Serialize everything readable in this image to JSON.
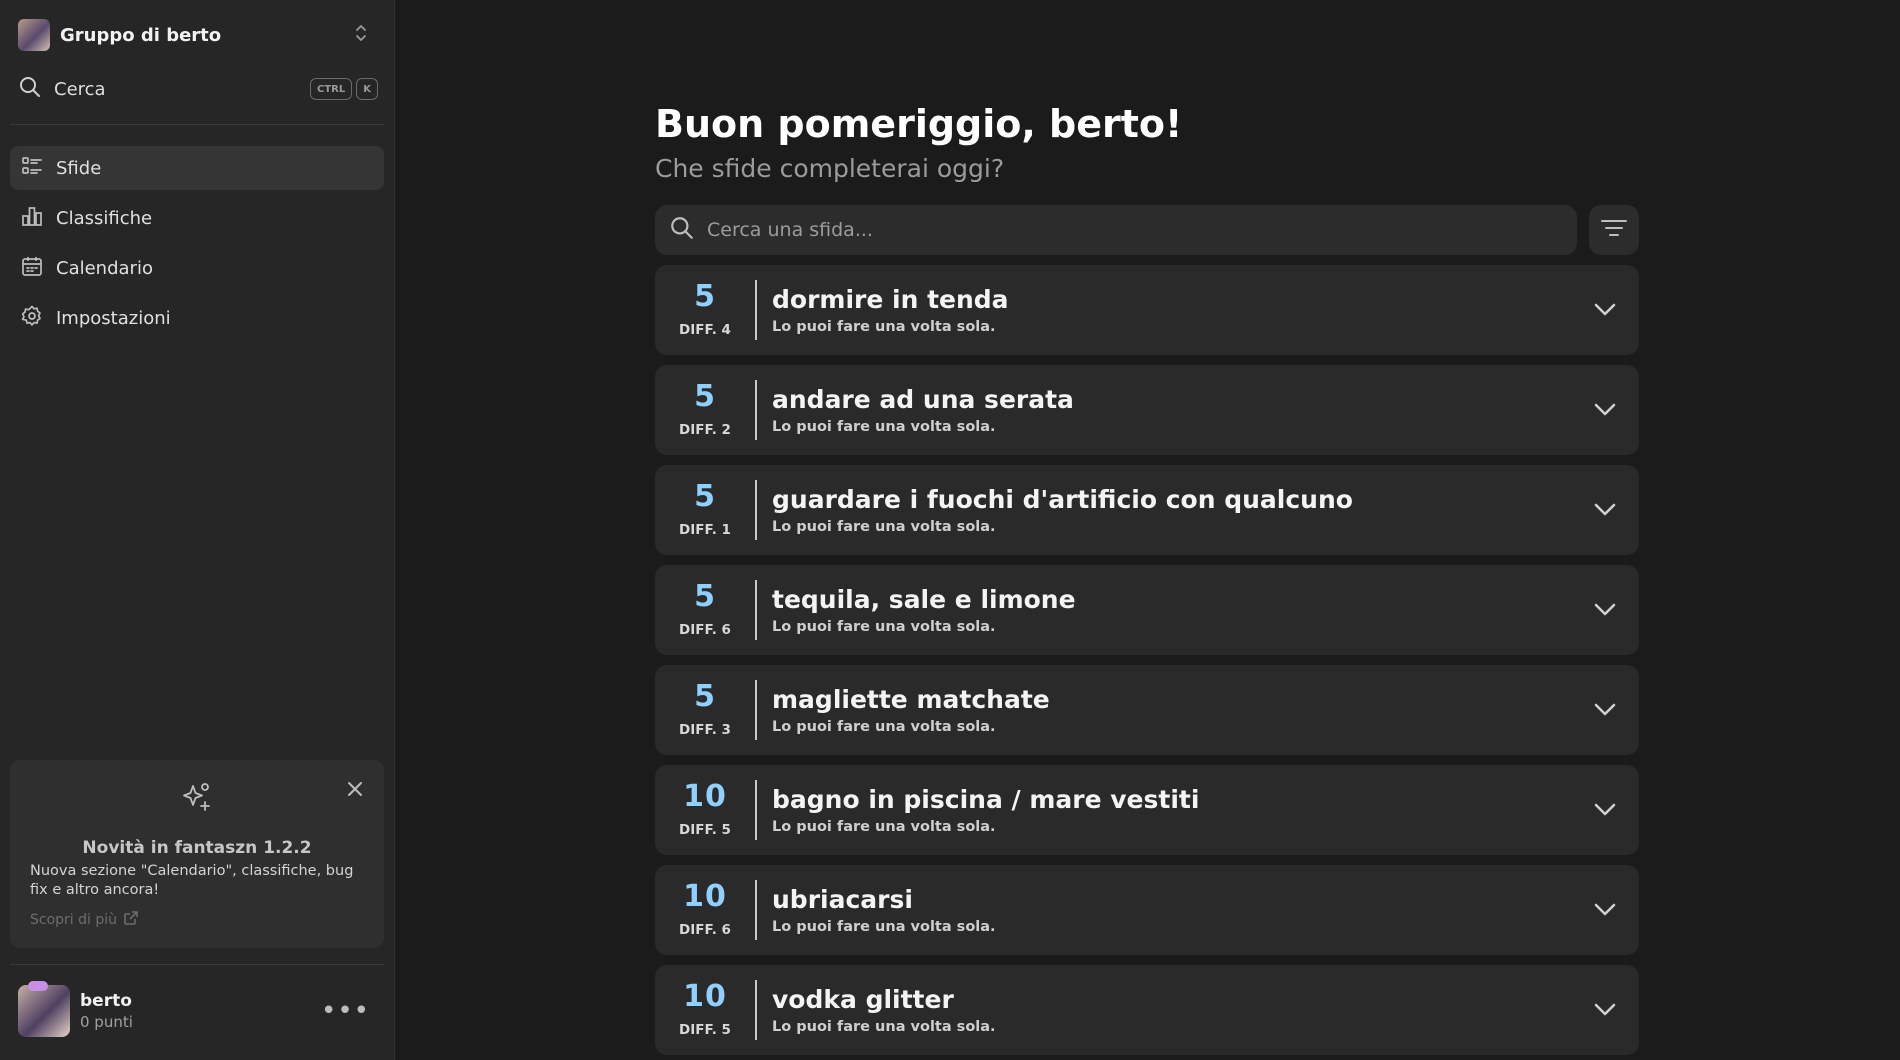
{
  "sidebar": {
    "group_name": "Gruppo di berto",
    "search_label": "Cerca",
    "shortcut": [
      "CTRL",
      "K"
    ],
    "nav": [
      {
        "label": "Sfide",
        "icon": "list-icon",
        "active": true
      },
      {
        "label": "Classifiche",
        "icon": "bar-chart-icon",
        "active": false
      },
      {
        "label": "Calendario",
        "icon": "calendar-icon",
        "active": false
      },
      {
        "label": "Impostazioni",
        "icon": "gear-icon",
        "active": false
      }
    ],
    "news": {
      "title": "Novità in fantaszn 1.2.2",
      "body": "Nuova sezione \"Calendario\", classifiche, bug fix e altro ancora!",
      "link": "Scopri di più"
    },
    "user": {
      "name": "berto",
      "points": "0 punti"
    }
  },
  "main": {
    "greeting": "Buon pomeriggio, berto!",
    "subtitle": "Che sfide completerai oggi?",
    "search_placeholder": "Cerca una sfida...",
    "challenges": [
      {
        "points": "5",
        "diff": "DIFF. 4",
        "title": "dormire in tenda",
        "note": "Lo puoi fare una volta sola."
      },
      {
        "points": "5",
        "diff": "DIFF. 2",
        "title": "andare ad una serata",
        "note": "Lo puoi fare una volta sola."
      },
      {
        "points": "5",
        "diff": "DIFF. 1",
        "title": "guardare i fuochi d'artificio con qualcuno",
        "note": "Lo puoi fare una volta sola."
      },
      {
        "points": "5",
        "diff": "DIFF. 6",
        "title": "tequila, sale e limone",
        "note": "Lo puoi fare una volta sola."
      },
      {
        "points": "5",
        "diff": "DIFF. 3",
        "title": "magliette matchate",
        "note": "Lo puoi fare una volta sola."
      },
      {
        "points": "10",
        "diff": "DIFF. 5",
        "title": "bagno in piscina / mare vestiti",
        "note": "Lo puoi fare una volta sola."
      },
      {
        "points": "10",
        "diff": "DIFF. 6",
        "title": "ubriacarsi",
        "note": "Lo puoi fare una volta sola."
      },
      {
        "points": "10",
        "diff": "DIFF. 5",
        "title": "vodka glitter",
        "note": "Lo puoi fare una volta sola."
      }
    ]
  },
  "colors": {
    "accent_points": "#8fd0ff",
    "background": "#1b1b1b",
    "sidebar": "#262626",
    "card": "#2a2a2a"
  }
}
